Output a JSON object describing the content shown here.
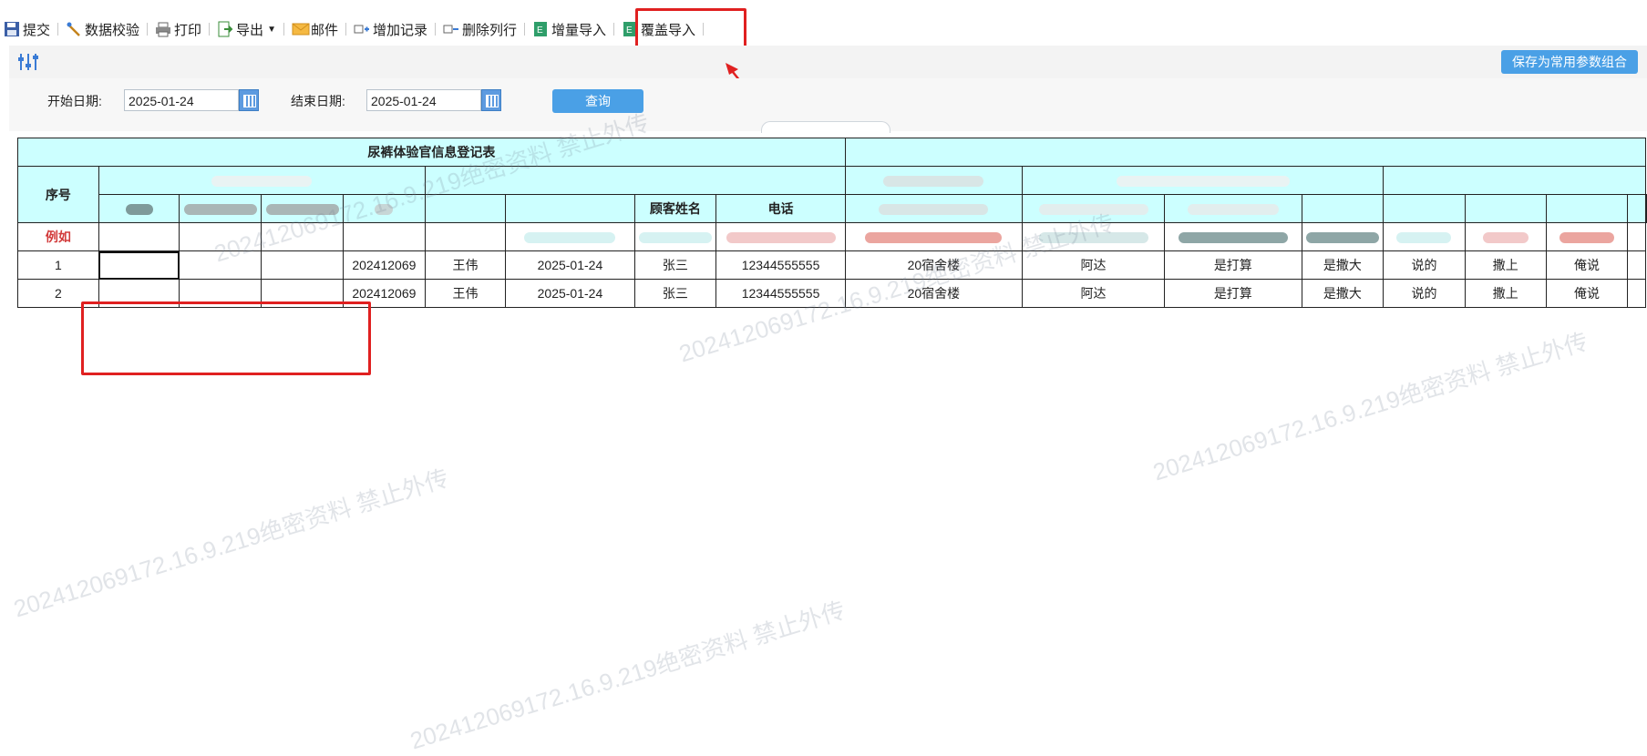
{
  "toolbar": {
    "items": [
      {
        "label": "提交",
        "icon": "save-icon"
      },
      {
        "label": "数据校验",
        "icon": "wand-icon"
      },
      {
        "label": "打印",
        "icon": "printer-icon"
      },
      {
        "label": "导出",
        "icon": "export-icon"
      },
      {
        "label": "邮件",
        "icon": "mail-icon"
      },
      {
        "label": "增加记录",
        "icon": "add-row-icon"
      },
      {
        "label": "删除列行",
        "icon": "delete-row-icon"
      },
      {
        "label": "增量导入",
        "icon": "excel-icon"
      },
      {
        "label": "覆盖导入",
        "icon": "excel-icon"
      }
    ]
  },
  "params": {
    "save_combo_label": "保存为常用参数组合",
    "icon": "sliders-icon"
  },
  "filters": {
    "start_label": "开始日期:",
    "start_value": "2025-01-24",
    "end_label": "结束日期:",
    "end_value": "2025-01-24",
    "query_label": "查询"
  },
  "sheet": {
    "title": "尿裤体验官信息登记表",
    "seq_header": "序号",
    "col_customer_name": "顾客姓名",
    "col_phone": "电话",
    "example_label": "例如",
    "rows": [
      {
        "seq": "1",
        "id": "202412069",
        "name": "王伟",
        "date": "2025-01-24",
        "customer": "张三",
        "phone": "12344555555",
        "addr": "20宿舍楼",
        "c1": "阿达",
        "c2": "是打算",
        "c3": "是撒大",
        "c4": "说的",
        "c5": "撒上",
        "c6": "俺说"
      },
      {
        "seq": "2",
        "id": "202412069",
        "name": "王伟",
        "date": "2025-01-24",
        "customer": "张三",
        "phone": "12344555555",
        "addr": "20宿舍楼",
        "c1": "阿达",
        "c2": "是打算",
        "c3": "是撒大",
        "c4": "说的",
        "c5": "撒上",
        "c6": "俺说"
      }
    ]
  },
  "watermark": "202412069172.16.9.219绝密资料 禁止外传",
  "colors": {
    "accent": "#4aa0e6",
    "header_bg": "#ccffff",
    "highlight": "#e02020"
  }
}
